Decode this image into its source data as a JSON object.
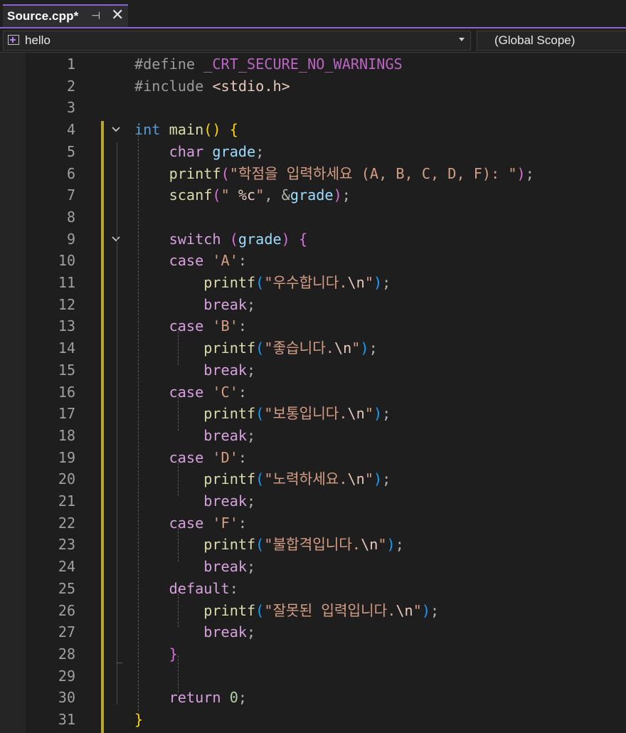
{
  "tab": {
    "title": "Source.cpp*",
    "pin_glyph": "⊣",
    "close_glyph": "✕"
  },
  "navbar": {
    "project": "hello",
    "scope": "(Global Scope)"
  },
  "line_numbers": [
    "1",
    "2",
    "3",
    "4",
    "5",
    "6",
    "7",
    "8",
    "9",
    "10",
    "11",
    "12",
    "13",
    "14",
    "15",
    "16",
    "17",
    "18",
    "19",
    "20",
    "21",
    "22",
    "23",
    "24",
    "25",
    "26",
    "27",
    "28",
    "29",
    "30",
    "31"
  ],
  "code_lines": [
    [
      [
        "pp",
        "#define "
      ],
      [
        "macro",
        "_CRT_SECURE_NO_WARNINGS"
      ]
    ],
    [
      [
        "pp",
        "#include "
      ],
      [
        "inc",
        "<stdio.h>"
      ]
    ],
    [],
    [
      [
        "kw",
        "int "
      ],
      [
        "fn",
        "main"
      ],
      [
        "p1",
        "()"
      ],
      [
        "punc",
        " "
      ],
      [
        "p1",
        "{"
      ]
    ],
    [
      [
        "punc",
        "    "
      ],
      [
        "kw2",
        "char "
      ],
      [
        "var",
        "grade"
      ],
      [
        "punc",
        ";"
      ]
    ],
    [
      [
        "punc",
        "    "
      ],
      [
        "fn",
        "printf"
      ],
      [
        "p2",
        "("
      ],
      [
        "str",
        "\"학점을 입력하세요 (A, B, C, D, F): \""
      ],
      [
        "p2",
        ")"
      ],
      [
        "punc",
        ";"
      ]
    ],
    [
      [
        "punc",
        "    "
      ],
      [
        "fn",
        "scanf"
      ],
      [
        "p2",
        "("
      ],
      [
        "str",
        "\" "
      ],
      [
        "esc",
        "%c"
      ],
      [
        "str",
        "\""
      ],
      [
        "punc",
        ", &"
      ],
      [
        "var",
        "grade"
      ],
      [
        "p2",
        ")"
      ],
      [
        "punc",
        ";"
      ]
    ],
    [],
    [
      [
        "punc",
        "    "
      ],
      [
        "kw2",
        "switch "
      ],
      [
        "p2",
        "("
      ],
      [
        "var",
        "grade"
      ],
      [
        "p2",
        ")"
      ],
      [
        "punc",
        " "
      ],
      [
        "p2",
        "{"
      ]
    ],
    [
      [
        "punc",
        "    "
      ],
      [
        "kw2",
        "case "
      ],
      [
        "str",
        "'A'"
      ],
      [
        "punc",
        ":"
      ]
    ],
    [
      [
        "punc",
        "        "
      ],
      [
        "fn",
        "printf"
      ],
      [
        "p3",
        "("
      ],
      [
        "str",
        "\"우수합니다."
      ],
      [
        "esc",
        "\\n"
      ],
      [
        "str",
        "\""
      ],
      [
        "p3",
        ")"
      ],
      [
        "punc",
        ";"
      ]
    ],
    [
      [
        "punc",
        "        "
      ],
      [
        "kw2",
        "break"
      ],
      [
        "punc",
        ";"
      ]
    ],
    [
      [
        "punc",
        "    "
      ],
      [
        "kw2",
        "case "
      ],
      [
        "str",
        "'B'"
      ],
      [
        "punc",
        ":"
      ]
    ],
    [
      [
        "punc",
        "        "
      ],
      [
        "fn",
        "printf"
      ],
      [
        "p3",
        "("
      ],
      [
        "str",
        "\"좋습니다."
      ],
      [
        "esc",
        "\\n"
      ],
      [
        "str",
        "\""
      ],
      [
        "p3",
        ")"
      ],
      [
        "punc",
        ";"
      ]
    ],
    [
      [
        "punc",
        "        "
      ],
      [
        "kw2",
        "break"
      ],
      [
        "punc",
        ";"
      ]
    ],
    [
      [
        "punc",
        "    "
      ],
      [
        "kw2",
        "case "
      ],
      [
        "str",
        "'C'"
      ],
      [
        "punc",
        ":"
      ]
    ],
    [
      [
        "punc",
        "        "
      ],
      [
        "fn",
        "printf"
      ],
      [
        "p3",
        "("
      ],
      [
        "str",
        "\"보통입니다."
      ],
      [
        "esc",
        "\\n"
      ],
      [
        "str",
        "\""
      ],
      [
        "p3",
        ")"
      ],
      [
        "punc",
        ";"
      ]
    ],
    [
      [
        "punc",
        "        "
      ],
      [
        "kw2",
        "break"
      ],
      [
        "punc",
        ";"
      ]
    ],
    [
      [
        "punc",
        "    "
      ],
      [
        "kw2",
        "case "
      ],
      [
        "str",
        "'D'"
      ],
      [
        "punc",
        ":"
      ]
    ],
    [
      [
        "punc",
        "        "
      ],
      [
        "fn",
        "printf"
      ],
      [
        "p3",
        "("
      ],
      [
        "str",
        "\"노력하세요."
      ],
      [
        "esc",
        "\\n"
      ],
      [
        "str",
        "\""
      ],
      [
        "p3",
        ")"
      ],
      [
        "punc",
        ";"
      ]
    ],
    [
      [
        "punc",
        "        "
      ],
      [
        "kw2",
        "break"
      ],
      [
        "punc",
        ";"
      ]
    ],
    [
      [
        "punc",
        "    "
      ],
      [
        "kw2",
        "case "
      ],
      [
        "str",
        "'F'"
      ],
      [
        "punc",
        ":"
      ]
    ],
    [
      [
        "punc",
        "        "
      ],
      [
        "fn",
        "printf"
      ],
      [
        "p3",
        "("
      ],
      [
        "str",
        "\"불합격입니다."
      ],
      [
        "esc",
        "\\n"
      ],
      [
        "str",
        "\""
      ],
      [
        "p3",
        ")"
      ],
      [
        "punc",
        ";"
      ]
    ],
    [
      [
        "punc",
        "        "
      ],
      [
        "kw2",
        "break"
      ],
      [
        "punc",
        ";"
      ]
    ],
    [
      [
        "punc",
        "    "
      ],
      [
        "kw2",
        "default"
      ],
      [
        "punc",
        ":"
      ]
    ],
    [
      [
        "punc",
        "        "
      ],
      [
        "fn",
        "printf"
      ],
      [
        "p3",
        "("
      ],
      [
        "str",
        "\"잘못된 입력입니다."
      ],
      [
        "esc",
        "\\n"
      ],
      [
        "str",
        "\""
      ],
      [
        "p3",
        ")"
      ],
      [
        "punc",
        ";"
      ]
    ],
    [
      [
        "punc",
        "        "
      ],
      [
        "kw2",
        "break"
      ],
      [
        "punc",
        ";"
      ]
    ],
    [
      [
        "punc",
        "    "
      ],
      [
        "p2",
        "}"
      ]
    ],
    [],
    [
      [
        "punc",
        "    "
      ],
      [
        "kw2",
        "return "
      ],
      [
        "num",
        "0"
      ],
      [
        "punc",
        ";"
      ]
    ],
    [
      [
        "p1",
        "}"
      ]
    ]
  ],
  "folds": [
    {
      "line": 4,
      "name": "fold-main-icon"
    },
    {
      "line": 9,
      "name": "fold-switch-icon"
    }
  ]
}
